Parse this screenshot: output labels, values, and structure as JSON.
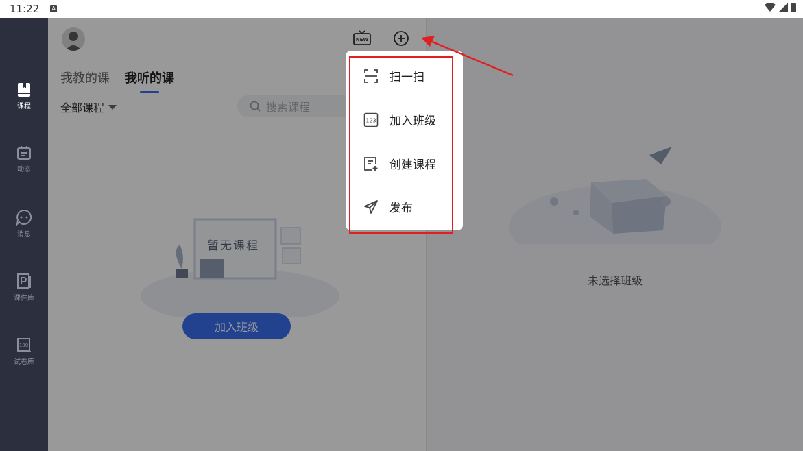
{
  "status_bar": {
    "time": "11:22",
    "notif_icon": "A"
  },
  "sidenav": {
    "items": [
      {
        "label": "课程",
        "icon": "book-icon",
        "active": true
      },
      {
        "label": "动态",
        "icon": "calendar-icon",
        "active": false
      },
      {
        "label": "消息",
        "icon": "chat-icon",
        "active": false
      },
      {
        "label": "课件库",
        "icon": "courseware-icon",
        "active": false
      },
      {
        "label": "试卷库",
        "icon": "exam-icon",
        "active": false
      }
    ]
  },
  "main": {
    "tabs": [
      {
        "label": "我教的课",
        "active": false
      },
      {
        "label": "我听的课",
        "active": true
      }
    ],
    "filter_label": "全部课程",
    "search_placeholder": "搜索课程",
    "empty_text": "暂无课程",
    "join_button": "加入班级"
  },
  "right_panel": {
    "empty_text": "未选择班级"
  },
  "popup_menu": {
    "items": [
      {
        "label": "扫一扫",
        "icon": "scan-icon"
      },
      {
        "label": "加入班级",
        "icon": "join-class-icon",
        "icon_text": "123"
      },
      {
        "label": "创建课程",
        "icon": "create-course-icon"
      },
      {
        "label": "发布",
        "icon": "send-icon"
      }
    ]
  },
  "colors": {
    "accent": "#3a6ff0",
    "highlight": "#e02020",
    "sidebar": "#2b2f3e"
  }
}
